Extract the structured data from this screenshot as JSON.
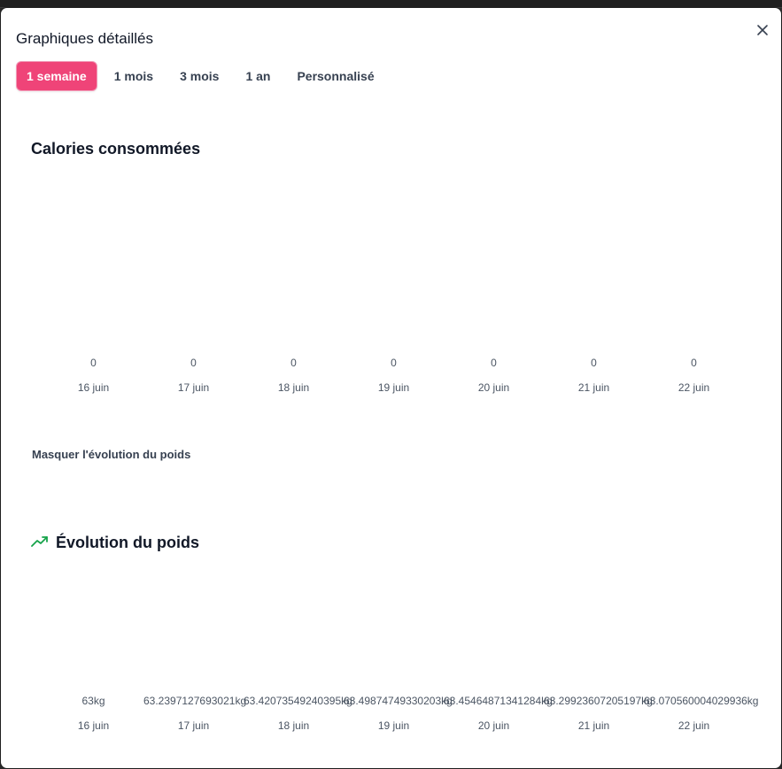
{
  "modal": {
    "title": "Graphiques détaillés",
    "close_symbol": "×"
  },
  "tabs": [
    {
      "label": "1 semaine",
      "active": true
    },
    {
      "label": "1 mois",
      "active": false
    },
    {
      "label": "3 mois",
      "active": false
    },
    {
      "label": "1 an",
      "active": false
    },
    {
      "label": "Personnalisé",
      "active": false
    }
  ],
  "calories": {
    "title": "Calories consommées",
    "values": [
      "0",
      "0",
      "0",
      "0",
      "0",
      "0",
      "0"
    ],
    "dates": [
      "16 juin",
      "17 juin",
      "18 juin",
      "19 juin",
      "20 juin",
      "21 juin",
      "22 juin"
    ]
  },
  "toggle_weight_label": "Masquer l'évolution du poids",
  "weight": {
    "title": "Évolution du poids",
    "icon": "trending-up-icon",
    "icon_color": "#16a34a",
    "values": [
      "63kg",
      "63.2397127693021kg",
      "63.42073549240395kg",
      "63.49874749330203kg",
      "63.45464871341284kg",
      "63.29923607205197kg",
      "63.070560004029936kg"
    ],
    "dates": [
      "16 juin",
      "17 juin",
      "18 juin",
      "19 juin",
      "20 juin",
      "21 juin",
      "22 juin"
    ]
  },
  "colors": {
    "accent": "#ef4478",
    "text": "#111827",
    "muted": "#4b5563"
  }
}
